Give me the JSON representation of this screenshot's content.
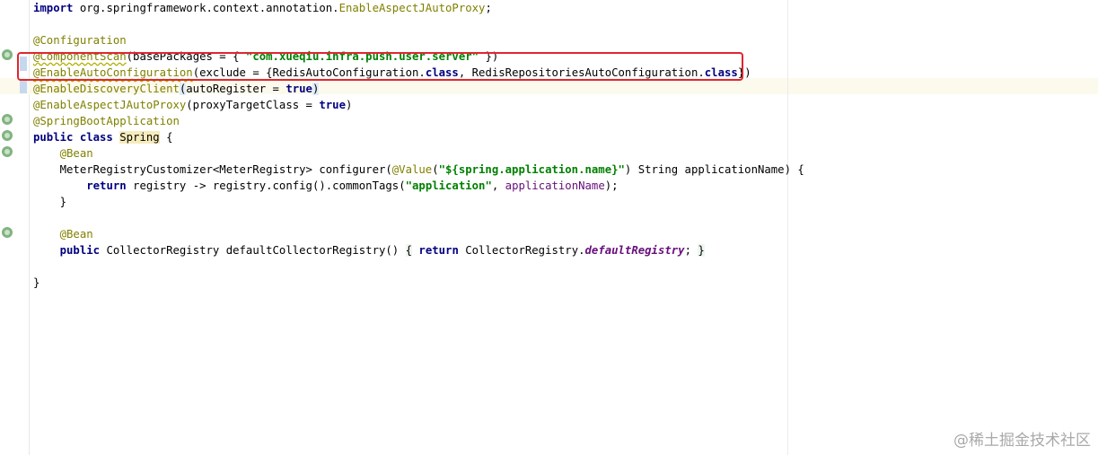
{
  "editor": {
    "lines": [
      {
        "tokens": [
          {
            "t": "import",
            "c": "kw"
          },
          {
            "t": " org.springframework.context.annotation.",
            "c": ""
          },
          {
            "t": "EnableAspectJAutoProxy",
            "c": "ann"
          },
          {
            "t": ";",
            "c": ""
          }
        ]
      },
      {
        "tokens": []
      },
      {
        "tokens": [
          {
            "t": "@Configuration",
            "c": "ann"
          }
        ]
      },
      {
        "tokens": [
          {
            "t": "@ComponentScan",
            "c": "ann squiggle"
          },
          {
            "t": "(basePackages = { ",
            "c": ""
          },
          {
            "t": "\"com.xueqiu.infra.push.user.server\"",
            "c": "str"
          },
          {
            "t": " })",
            "c": ""
          }
        ]
      },
      {
        "tokens": [
          {
            "t": "@EnableAutoConfiguration",
            "c": "ann squiggle"
          },
          {
            "t": "(exclude = {RedisAutoConfiguration.",
            "c": ""
          },
          {
            "t": "class",
            "c": "kw"
          },
          {
            "t": ", RedisRepositoriesAutoConfiguration.",
            "c": ""
          },
          {
            "t": "class",
            "c": "kw"
          },
          {
            "t": "})",
            "c": ""
          }
        ]
      },
      {
        "tokens": [
          {
            "t": "@EnableDiscoveryClient",
            "c": "ann"
          },
          {
            "t": "(",
            "c": "caret-box"
          },
          {
            "t": "autoRegister = ",
            "c": ""
          },
          {
            "t": "true",
            "c": "kw"
          },
          {
            "t": ")",
            "c": "caret-box"
          }
        ]
      },
      {
        "tokens": [
          {
            "t": "@EnableAspectJAutoProxy",
            "c": "ann"
          },
          {
            "t": "(proxyTargetClass = ",
            "c": ""
          },
          {
            "t": "true",
            "c": "kw"
          },
          {
            "t": ")",
            "c": ""
          }
        ]
      },
      {
        "tokens": [
          {
            "t": "@SpringBootApplication",
            "c": "ann"
          }
        ]
      },
      {
        "tokens": [
          {
            "t": "public class ",
            "c": "kw"
          },
          {
            "t": "Spring",
            "c": "cls-highlight"
          },
          {
            "t": " {",
            "c": ""
          }
        ]
      },
      {
        "tokens": [
          {
            "t": "    ",
            "c": ""
          },
          {
            "t": "@Bean",
            "c": "ann"
          }
        ]
      },
      {
        "tokens": [
          {
            "t": "    MeterRegistryCustomizer<MeterRegistry> configurer(",
            "c": ""
          },
          {
            "t": "@Value",
            "c": "ann"
          },
          {
            "t": "(",
            "c": ""
          },
          {
            "t": "\"${spring.application.name}\"",
            "c": "str"
          },
          {
            "t": ") String applicationName) {",
            "c": ""
          }
        ]
      },
      {
        "tokens": [
          {
            "t": "        ",
            "c": ""
          },
          {
            "t": "return",
            "c": "kw"
          },
          {
            "t": " registry -> registry.config().commonTags(",
            "c": ""
          },
          {
            "t": "\"application\"",
            "c": "str"
          },
          {
            "t": ", ",
            "c": ""
          },
          {
            "t": "applicationName",
            "c": "param"
          },
          {
            "t": ");",
            "c": ""
          }
        ]
      },
      {
        "tokens": [
          {
            "t": "    }",
            "c": ""
          }
        ]
      },
      {
        "tokens": []
      },
      {
        "tokens": [
          {
            "t": "    ",
            "c": ""
          },
          {
            "t": "@Bean",
            "c": "ann"
          }
        ]
      },
      {
        "tokens": [
          {
            "t": "    ",
            "c": ""
          },
          {
            "t": "public",
            "c": "kw"
          },
          {
            "t": " CollectorRegistry defaultCollectorRegistry() ",
            "c": ""
          },
          {
            "t": "{",
            "c": "fold-bg"
          },
          {
            "t": " ",
            "c": ""
          },
          {
            "t": "return",
            "c": "kw"
          },
          {
            "t": " CollectorRegistry.",
            "c": ""
          },
          {
            "t": "defaultRegistry",
            "c": "static-call"
          },
          {
            "t": "; ",
            "c": ""
          },
          {
            "t": "}",
            "c": "fold-bg"
          }
        ]
      },
      {
        "tokens": []
      },
      {
        "tokens": [
          {
            "t": "}",
            "c": ""
          }
        ]
      }
    ]
  },
  "watermark": "@稀土掘金技术社区",
  "gutter_icons": [
    "spring-bean-icon",
    "spring-bean-icon",
    "spring-boot-icon",
    "spring-bean-icon",
    "spring-bean-icon"
  ],
  "colors": {
    "highlight_box": "#e0262f",
    "annotation": "#808000",
    "keyword": "#000080",
    "string": "#008000"
  }
}
